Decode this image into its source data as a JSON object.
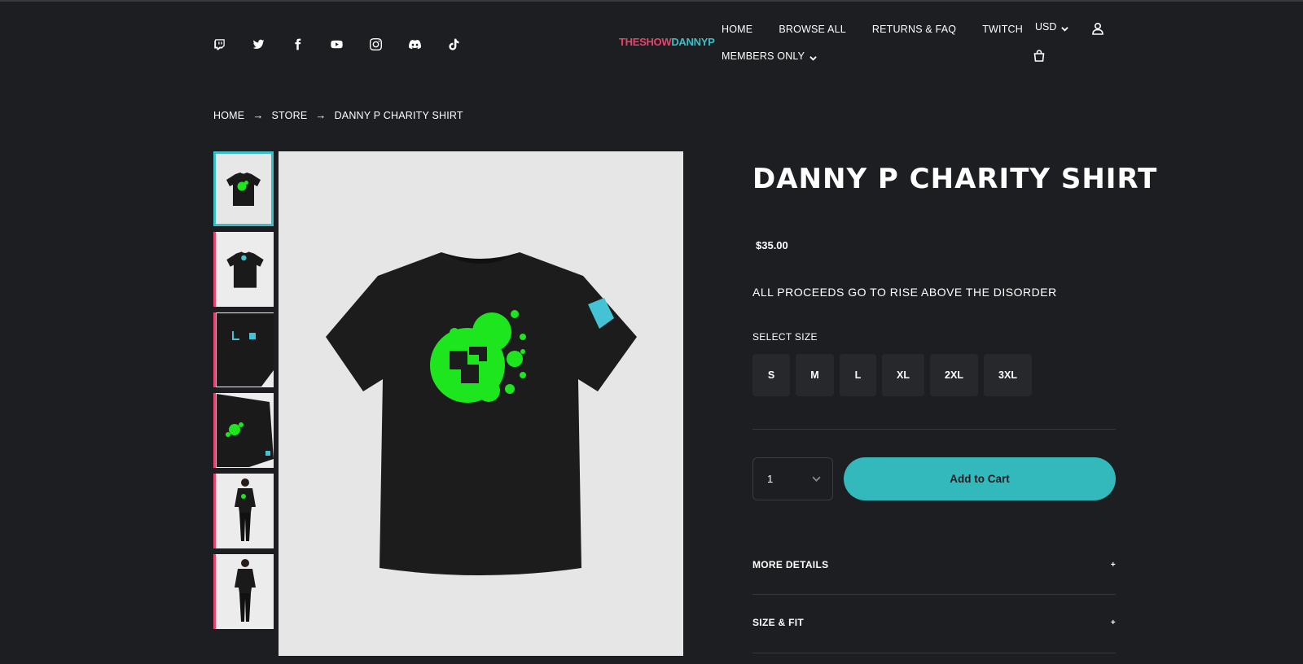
{
  "colors": {
    "background": "#1d1e21",
    "accent_teal": "#33b8bc",
    "accent_pink": "#e8436f"
  },
  "social": [
    "twitch-icon",
    "twitter-icon",
    "facebook-icon",
    "youtube-icon",
    "instagram-icon",
    "discord-icon",
    "tiktok-icon"
  ],
  "brand": {
    "part1": "THESHOW",
    "part2": "DANNYP"
  },
  "nav": {
    "home": "HOME",
    "browse_all": "BROWSE ALL",
    "returns": "RETURNS & FAQ",
    "twitch": "TWITCH",
    "members": "MEMBERS ONLY"
  },
  "currency": "USD",
  "breadcrumb": {
    "home": "HOME",
    "store": "STORE",
    "current": "DANNY P CHARITY SHIRT",
    "sep": "→"
  },
  "product": {
    "title": "DANNY P CHARITY SHIRT",
    "price": "$35.00",
    "description": "ALL PROCEEDS GO TO RISE ABOVE THE DISORDER",
    "size_label": "SELECT SIZE",
    "sizes": [
      "S",
      "M",
      "L",
      "XL",
      "2XL",
      "3XL"
    ],
    "quantity": "1",
    "add_to_cart": "Add to Cart",
    "accordions": [
      {
        "label": "MORE DETAILS",
        "icon": "+"
      },
      {
        "label": "SIZE & FIT",
        "icon": "+"
      }
    ]
  }
}
